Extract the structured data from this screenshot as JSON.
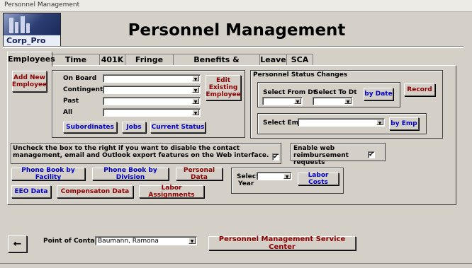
{
  "window": {
    "title": "Personnel Management"
  },
  "logo": {
    "text_prefix": "Corp_",
    "text_bold": "Pro"
  },
  "header": {
    "title": "Personnel Management"
  },
  "tabs": [
    {
      "label": "Employees",
      "active": true
    },
    {
      "label": "Time Sheets"
    },
    {
      "label": "401K"
    },
    {
      "label": "Fringe Costs"
    },
    {
      "label": "Benefits & Withholdings"
    },
    {
      "label": "Leave"
    },
    {
      "label": "SCA"
    }
  ],
  "employees": {
    "add_new_label": "Add New Employee",
    "edit_existing_label": "Edit Existing Employee",
    "filters": [
      {
        "label": "On Board",
        "value": ""
      },
      {
        "label": "Contingent",
        "value": ""
      },
      {
        "label": "Past",
        "value": ""
      },
      {
        "label": "All",
        "value": ""
      }
    ],
    "subordinates_label": "Subordinates",
    "jobs_label": "Jobs",
    "current_status_label": "Current Status"
  },
  "status_changes": {
    "title": "Personnel Status Changes",
    "from_label": "Select From Dt",
    "to_label": "Select To Dt",
    "by_date_label": "by Date",
    "record_label": "Record",
    "emp_label": "Select Emp",
    "by_emp_label": "by Emp"
  },
  "options": {
    "uncheck_text": "Uncheck the box to the right if you want to disable the contact management, email and Outlook export features on the Web interface.",
    "uncheck_checked": true,
    "reimburse_text": "Enable web reimbursement requests",
    "reimburse_checked": true,
    "check_mark": "✔"
  },
  "reports": {
    "phone_facility": "Phone Book by Facility",
    "phone_division": "Phone Book by Division",
    "personal_data": "Personal Data",
    "eeo_data": "EEO Data",
    "compensation": "Compensaton  Data",
    "labor_assignments": "Labor Assignments"
  },
  "labor": {
    "select_label": "Select",
    "year_label": "Year",
    "year_value": "",
    "labor_costs_label": "Labor Costs"
  },
  "footer": {
    "back_icon": "←",
    "poc_label": "Point of Contact",
    "poc_value": "Baumann, Ramona",
    "service_center_label": "Personnel Management Service Center"
  },
  "icons": {
    "dropdown": "▼",
    "back": "arrow-left-icon"
  },
  "colors": {
    "link_blue": "#0000c8",
    "maroon": "#8b0000",
    "background": "#d4d0c8"
  }
}
